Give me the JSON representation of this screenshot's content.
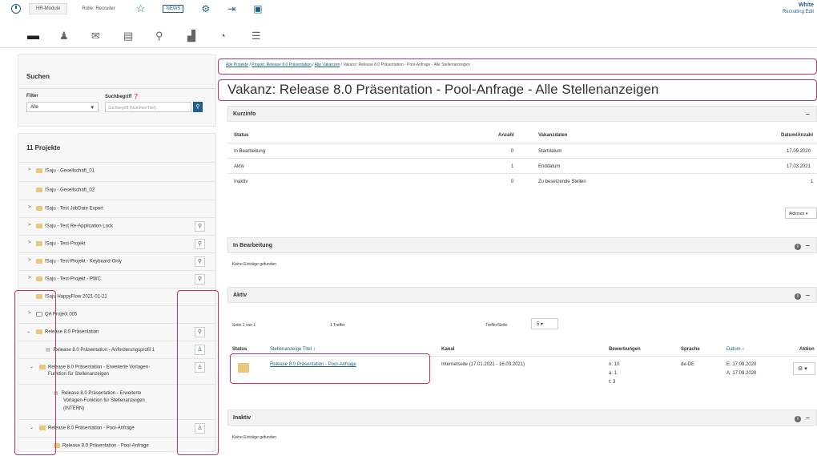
{
  "topbar": {
    "tabs": [
      "HR-Module",
      "Rolle: Recruiter"
    ],
    "news": "NEWS",
    "brand_name": "White",
    "brand_sub": "Recruiting Edit"
  },
  "search": {
    "title": "Suchen",
    "filter_label": "Filter",
    "term_label": "Suchbegriff",
    "filter_value": "Alle",
    "term_placeholder": "Suchbegriff (Nummer/Titel)"
  },
  "projects": {
    "title": "11 Projekte",
    "items": [
      "!Saju - Gesellschaft_01",
      "!Saju - Gesellschaft_02",
      "!Saju - Test JobDate Export",
      "!Saju - Test Re-Application Lock",
      "!Saju - Test-Projekt",
      "!Saju - Test-Projekt - Keyboard-Only",
      "!Saju - Test-Projekt - PWC",
      "!Saju HappyFlow 2021-01-21",
      "QA Project 005",
      "Release 8.0 Präsentation",
      "Release 8.0 Präsentation - Anforderungsprofil 1",
      "Release 8.0 Präsentation - Erweiterte Vorlagen-",
      "Funktion für Stellenanzeigen",
      "Release 8.0 Präsentation - Erweiterte",
      "Vorlagen-Funktion für Stellenanzeigen",
      "(INTERN)",
      "Release 8.0 Präsentation - Pool-Anfrage",
      "Release 8.0 Präsentation - Pool-Anfrage"
    ]
  },
  "breadcrumb": {
    "link1": "Alle Projekte",
    "link2": "Projekt: Release 8.0 Präsentation",
    "link3": "Alle Vakanzen",
    "current": "Vakanz: Release 8.0 Präsentation - Pool-Anfrage - Alle Stellenanzeigen",
    "sep": "/"
  },
  "page_title": "Vakanz: Release 8.0 Präsentation - Pool-Anfrage - Alle Stellenanzeigen",
  "kurzinfo": {
    "title": "Kurzinfo",
    "status_h": "Status",
    "anzahl_h": "Anzahl",
    "eckdaten_h": "Vakanzdaten",
    "datum_h": "Datum/Anzahl",
    "rows": [
      {
        "status": "In Bearbeitung",
        "count": "0",
        "label": "Startdatum",
        "value": "17.09.2020"
      },
      {
        "status": "Aktiv",
        "count": "1",
        "label": "Enddatum",
        "value": "17.03.2021"
      },
      {
        "status": "Inaktiv",
        "count": "0",
        "label": "Zu besetzende Stellen",
        "value": "1"
      }
    ]
  },
  "aktionen_label": "Aktionen ▾",
  "in_bearbeitung": {
    "title": "In Bearbeitung",
    "empty": "Keine Einträge gefunden"
  },
  "aktiv": {
    "title": "Aktiv",
    "page_info": "Seite 1 von 1",
    "hits": "1 Treffer",
    "per_page_label": "Treffer/Seite",
    "per_page_value": "5 ▾",
    "headers": {
      "status": "Status",
      "title": "Stellenanzeige Titel ↕",
      "kanal": "Kanal",
      "bewerbungen": "Bewerbungen",
      "sprache": "Sprache",
      "datum": "Datum ↕",
      "aktion": "Aktion"
    },
    "row": {
      "title": "Release 8.0 Präsentation - Pool-Anfrage",
      "kanal": "Internetseite (17.01.2021 - 16.03.2021)",
      "bew_n": "n: 10",
      "bew_a": "a: 1",
      "bew_t": "t: 3",
      "sprache": "de-DE",
      "datum_e": "E: 17.09.2020",
      "datum_a": "A: 17.09.2020",
      "action": "⚙ ▾"
    }
  },
  "inaktiv": {
    "title": "Inaktiv",
    "empty": "Keine Einträge gefunden"
  }
}
